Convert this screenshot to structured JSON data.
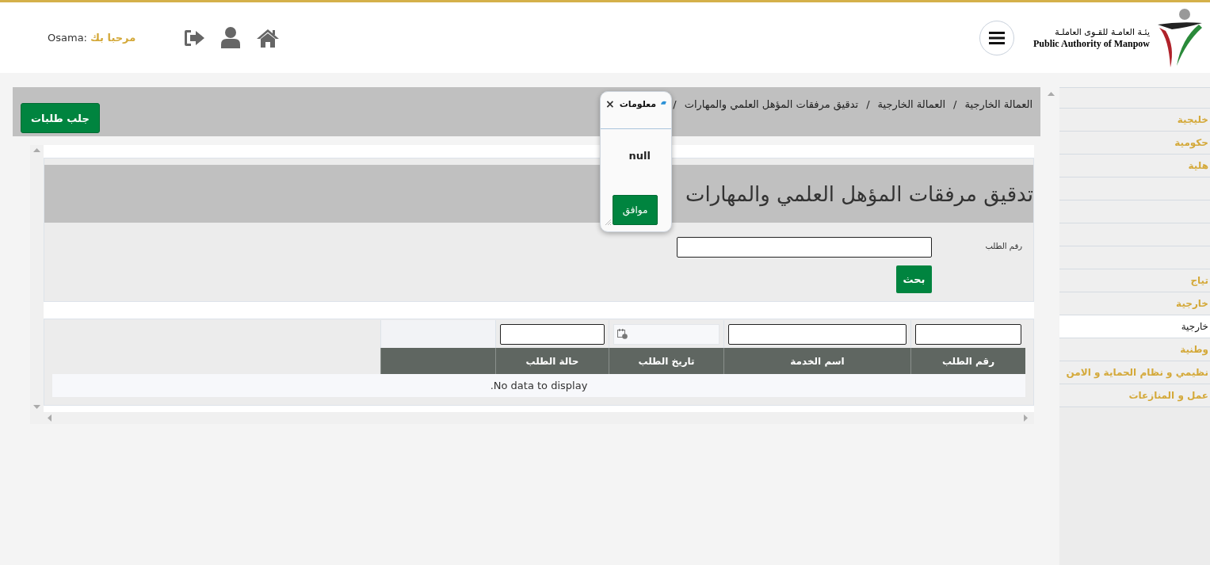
{
  "header": {
    "logo_text_ar": "يئـة العامـة للقـوى العاملـة",
    "logo_text_en": "Public Authority of Manpow",
    "greeting": "مرحبا بك",
    "user_name": "Osama:"
  },
  "sidebar": {
    "items": [
      {
        "selected": false
      },
      {
        "label": "خليجية",
        "selected": false
      },
      {
        "label": "حكومية",
        "selected": false
      },
      {
        "label": "هلية",
        "selected": false
      },
      {
        "selected": false
      },
      {
        "selected": false
      },
      {
        "selected": false
      },
      {
        "selected": false
      },
      {
        "label": "تياج",
        "selected": false
      },
      {
        "label": "خارجية",
        "selected": false
      },
      {
        "label": "خارجية",
        "selected": true
      },
      {
        "label": "وطنية",
        "selected": false
      },
      {
        "label": "نظيمي و نظام الحماية و الامن",
        "selected": false
      },
      {
        "label": "عمل و المنازعات",
        "selected": false
      }
    ]
  },
  "breadcrumb": {
    "separator": "/",
    "items": [
      "العمالة الخارجية",
      "العمالة الخارجية",
      "تدقيق مرفقات المؤهل العلمي والمهارات"
    ]
  },
  "fetch_button": "جلب طلبات",
  "page_title": "تدقيق مرفقات المؤهل العلمي والمهارات",
  "search": {
    "label": "رقم الطلب",
    "button": "بحث"
  },
  "grid": {
    "columns": [
      {
        "label": "رقم الطلب",
        "kind": "text"
      },
      {
        "label": "اسم الخدمة",
        "kind": "text"
      },
      {
        "label": "تاريخ الطلب",
        "kind": "date"
      },
      {
        "label": "حالة الطلب",
        "kind": "text"
      }
    ],
    "empty_text": "No data to display."
  },
  "dialog": {
    "title": "معلومات",
    "close": "×",
    "message": "null",
    "ok_button": "موافق"
  }
}
